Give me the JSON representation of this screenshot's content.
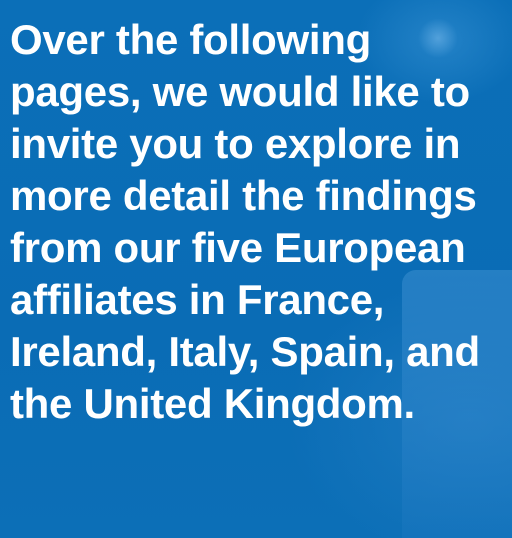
{
  "body_text": "Over the following pages, we would like to invite you to explore in more detail the findings from our five European affiliates in France, Ireland, Italy, Spain, and the United Kingdom.",
  "colors": {
    "background": "#0a6db6",
    "text": "#ffffff"
  }
}
